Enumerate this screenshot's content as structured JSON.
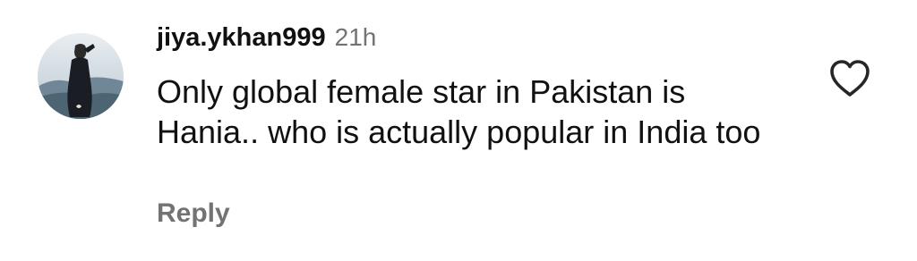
{
  "comment": {
    "username": "jiya.ykhan999",
    "timestamp": "21h",
    "text": "Only global female star in Pakistan is Hania.. who is actually popular in India too",
    "reply_label": "Reply",
    "avatar_icon": "profile-photo",
    "like_icon": "heart-outline-icon"
  },
  "colors": {
    "secondary_text": "#737373",
    "primary_text": "#111111",
    "icon": "#262626"
  }
}
